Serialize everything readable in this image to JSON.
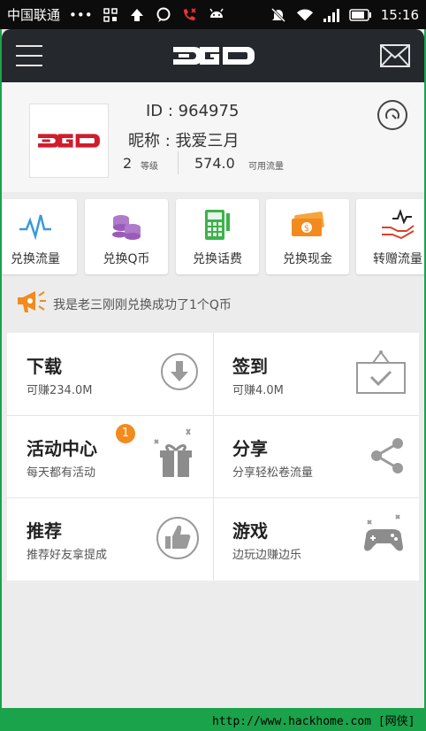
{
  "status_bar": {
    "carrier": "中国联通",
    "dots": "•••",
    "time": "15:16",
    "icons": [
      "grid-icon",
      "upload-arrow-icon",
      "chat-bubble-icon",
      "missed-call-icon",
      "android-icon",
      "mute-icon",
      "wifi-icon",
      "signal-icon",
      "battery-icon"
    ]
  },
  "header": {
    "logo_icon": "ego-logo",
    "menu_icon": "hamburger-icon",
    "mail_icon": "mail-icon"
  },
  "profile": {
    "id_label": "ID : 964975",
    "nickname_label": "昵称 : 我爱三月",
    "level_value": "2",
    "level_label": "等级",
    "flow_value": "574.0",
    "flow_label": "可用流量",
    "speed_icon": "speedometer-icon"
  },
  "quick_actions": [
    {
      "label": "兑换流量",
      "icon": "pulse-icon"
    },
    {
      "label": "兑换Q币",
      "icon": "coins-icon"
    },
    {
      "label": "兑换话费",
      "icon": "calculator-icon"
    },
    {
      "label": "兑换现金",
      "icon": "cash-icon"
    },
    {
      "label": "转赠流量",
      "icon": "gift-hand-icon"
    }
  ],
  "notice": {
    "icon": "megaphone-icon",
    "text": "我是老三刚刚兑换成功了1个Q币"
  },
  "tiles": [
    {
      "title": "下载",
      "subtitle": "可赚234.0M",
      "icon": "download-icon"
    },
    {
      "title": "签到",
      "subtitle": "可赚4.0M",
      "icon": "checkin-icon"
    },
    {
      "title": "活动中心",
      "subtitle": "每天都有活动",
      "icon": "gift-box-icon",
      "badge": "1"
    },
    {
      "title": "分享",
      "subtitle": "分享轻松卷流量",
      "icon": "share-icon"
    },
    {
      "title": "推荐",
      "subtitle": "推荐好友拿提成",
      "icon": "thumbs-up-icon"
    },
    {
      "title": "游戏",
      "subtitle": "边玩边赚边乐",
      "icon": "gamepad-icon"
    }
  ],
  "watermark": "http://www.hackhome.com [网侠]提供",
  "colors": {
    "accent_orange": "#f28a1d",
    "header_dark": "#25282d",
    "frame_green": "#1aa34a",
    "logo_red": "#d01c2c"
  }
}
